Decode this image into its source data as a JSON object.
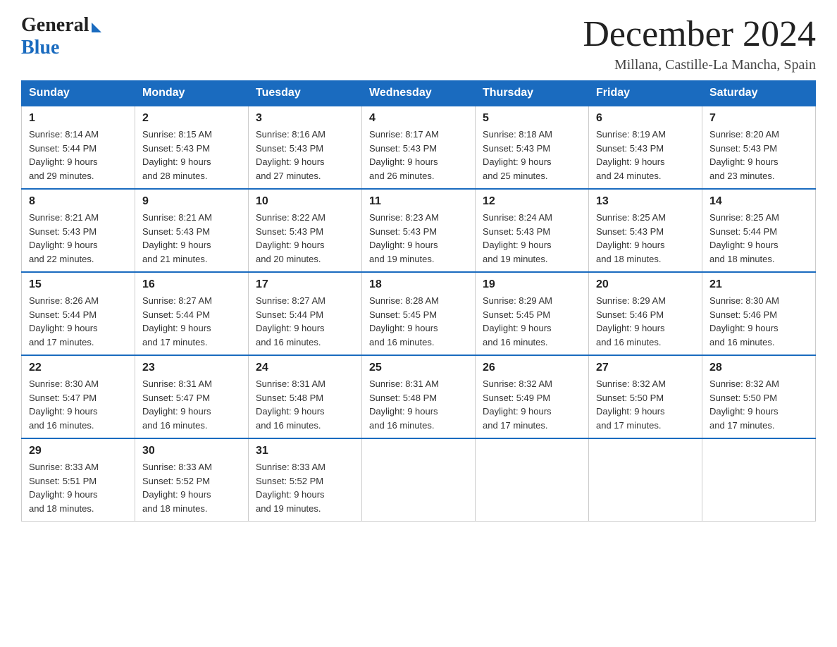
{
  "header": {
    "logo_general": "General",
    "logo_blue": "Blue",
    "month_title": "December 2024",
    "location": "Millana, Castille-La Mancha, Spain"
  },
  "days_of_week": [
    "Sunday",
    "Monday",
    "Tuesday",
    "Wednesday",
    "Thursday",
    "Friday",
    "Saturday"
  ],
  "weeks": [
    [
      {
        "day": "1",
        "sunrise": "8:14 AM",
        "sunset": "5:44 PM",
        "daylight": "9 hours and 29 minutes."
      },
      {
        "day": "2",
        "sunrise": "8:15 AM",
        "sunset": "5:43 PM",
        "daylight": "9 hours and 28 minutes."
      },
      {
        "day": "3",
        "sunrise": "8:16 AM",
        "sunset": "5:43 PM",
        "daylight": "9 hours and 27 minutes."
      },
      {
        "day": "4",
        "sunrise": "8:17 AM",
        "sunset": "5:43 PM",
        "daylight": "9 hours and 26 minutes."
      },
      {
        "day": "5",
        "sunrise": "8:18 AM",
        "sunset": "5:43 PM",
        "daylight": "9 hours and 25 minutes."
      },
      {
        "day": "6",
        "sunrise": "8:19 AM",
        "sunset": "5:43 PM",
        "daylight": "9 hours and 24 minutes."
      },
      {
        "day": "7",
        "sunrise": "8:20 AM",
        "sunset": "5:43 PM",
        "daylight": "9 hours and 23 minutes."
      }
    ],
    [
      {
        "day": "8",
        "sunrise": "8:21 AM",
        "sunset": "5:43 PM",
        "daylight": "9 hours and 22 minutes."
      },
      {
        "day": "9",
        "sunrise": "8:21 AM",
        "sunset": "5:43 PM",
        "daylight": "9 hours and 21 minutes."
      },
      {
        "day": "10",
        "sunrise": "8:22 AM",
        "sunset": "5:43 PM",
        "daylight": "9 hours and 20 minutes."
      },
      {
        "day": "11",
        "sunrise": "8:23 AM",
        "sunset": "5:43 PM",
        "daylight": "9 hours and 19 minutes."
      },
      {
        "day": "12",
        "sunrise": "8:24 AM",
        "sunset": "5:43 PM",
        "daylight": "9 hours and 19 minutes."
      },
      {
        "day": "13",
        "sunrise": "8:25 AM",
        "sunset": "5:43 PM",
        "daylight": "9 hours and 18 minutes."
      },
      {
        "day": "14",
        "sunrise": "8:25 AM",
        "sunset": "5:44 PM",
        "daylight": "9 hours and 18 minutes."
      }
    ],
    [
      {
        "day": "15",
        "sunrise": "8:26 AM",
        "sunset": "5:44 PM",
        "daylight": "9 hours and 17 minutes."
      },
      {
        "day": "16",
        "sunrise": "8:27 AM",
        "sunset": "5:44 PM",
        "daylight": "9 hours and 17 minutes."
      },
      {
        "day": "17",
        "sunrise": "8:27 AM",
        "sunset": "5:44 PM",
        "daylight": "9 hours and 16 minutes."
      },
      {
        "day": "18",
        "sunrise": "8:28 AM",
        "sunset": "5:45 PM",
        "daylight": "9 hours and 16 minutes."
      },
      {
        "day": "19",
        "sunrise": "8:29 AM",
        "sunset": "5:45 PM",
        "daylight": "9 hours and 16 minutes."
      },
      {
        "day": "20",
        "sunrise": "8:29 AM",
        "sunset": "5:46 PM",
        "daylight": "9 hours and 16 minutes."
      },
      {
        "day": "21",
        "sunrise": "8:30 AM",
        "sunset": "5:46 PM",
        "daylight": "9 hours and 16 minutes."
      }
    ],
    [
      {
        "day": "22",
        "sunrise": "8:30 AM",
        "sunset": "5:47 PM",
        "daylight": "9 hours and 16 minutes."
      },
      {
        "day": "23",
        "sunrise": "8:31 AM",
        "sunset": "5:47 PM",
        "daylight": "9 hours and 16 minutes."
      },
      {
        "day": "24",
        "sunrise": "8:31 AM",
        "sunset": "5:48 PM",
        "daylight": "9 hours and 16 minutes."
      },
      {
        "day": "25",
        "sunrise": "8:31 AM",
        "sunset": "5:48 PM",
        "daylight": "9 hours and 16 minutes."
      },
      {
        "day": "26",
        "sunrise": "8:32 AM",
        "sunset": "5:49 PM",
        "daylight": "9 hours and 17 minutes."
      },
      {
        "day": "27",
        "sunrise": "8:32 AM",
        "sunset": "5:50 PM",
        "daylight": "9 hours and 17 minutes."
      },
      {
        "day": "28",
        "sunrise": "8:32 AM",
        "sunset": "5:50 PM",
        "daylight": "9 hours and 17 minutes."
      }
    ],
    [
      {
        "day": "29",
        "sunrise": "8:33 AM",
        "sunset": "5:51 PM",
        "daylight": "9 hours and 18 minutes."
      },
      {
        "day": "30",
        "sunrise": "8:33 AM",
        "sunset": "5:52 PM",
        "daylight": "9 hours and 18 minutes."
      },
      {
        "day": "31",
        "sunrise": "8:33 AM",
        "sunset": "5:52 PM",
        "daylight": "9 hours and 19 minutes."
      },
      null,
      null,
      null,
      null
    ]
  ]
}
